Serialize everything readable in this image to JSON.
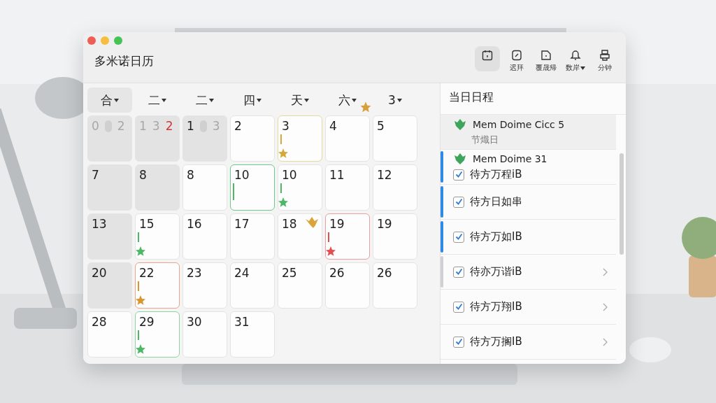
{
  "window": {
    "title": "多米诺日历",
    "controls": [
      {
        "kind": "close"
      },
      {
        "kind": "minimize"
      },
      {
        "kind": "zoom"
      }
    ]
  },
  "toolbar": [
    {
      "kind": "calendar",
      "selected": true
    },
    {
      "kind": "note",
      "label": "迟拜",
      "selected": false
    },
    {
      "kind": "file",
      "label": "覆晟帰",
      "selected": false
    },
    {
      "kind": "bell",
      "label": "数岸",
      "caret": true,
      "selected": false
    },
    {
      "kind": "printer",
      "label": "分钟",
      "selected": false
    }
  ],
  "weekdays": [
    {
      "label": "合",
      "selected": true
    },
    {
      "label": "二",
      "selected": false
    },
    {
      "label": "二",
      "selected": false
    },
    {
      "label": "四",
      "selected": false
    },
    {
      "label": "天",
      "selected": false
    },
    {
      "label": "六",
      "selected": false,
      "star": true
    },
    {
      "label": "3",
      "selected": false
    }
  ],
  "cells": [
    {
      "shaded": true,
      "parts": [
        {
          "kind": "number",
          "text": "0",
          "dimmed": true,
          "alert": false
        },
        {
          "kind": "pill"
        },
        {
          "kind": "number",
          "text": "2",
          "dimmed": true,
          "alert": false
        }
      ]
    },
    {
      "shaded": true,
      "parts": [
        {
          "kind": "number",
          "text": "1",
          "dimmed": true,
          "alert": false
        },
        {
          "kind": "number",
          "text": "3",
          "dimmed": true,
          "alert": false
        },
        {
          "kind": "number",
          "text": "2",
          "dimmed": false,
          "alert": true
        }
      ]
    },
    {
      "shaded": true,
      "parts": [
        {
          "kind": "number",
          "text": "1",
          "dimmed": false,
          "alert": false
        },
        {
          "kind": "pill"
        },
        {
          "kind": "number",
          "text": "3",
          "dimmed": true,
          "alert": false
        }
      ]
    },
    {
      "shaded": false,
      "parts": [
        {
          "kind": "number",
          "text": "2",
          "dimmed": false,
          "alert": false
        }
      ]
    },
    {
      "shaded": false,
      "parts": [
        {
          "kind": "number",
          "text": "3",
          "dimmed": false,
          "alert": false
        }
      ],
      "outline": {
        "color": "#e6d9a0"
      },
      "marker": {
        "color": "#d4a93a",
        "star": true
      }
    },
    {
      "shaded": false,
      "parts": [
        {
          "kind": "number",
          "text": "4",
          "dimmed": false,
          "alert": false
        }
      ]
    },
    {
      "shaded": false,
      "parts": [
        {
          "kind": "number",
          "text": "5",
          "dimmed": false,
          "alert": false
        }
      ]
    },
    {
      "shaded": true,
      "parts": [
        {
          "kind": "number",
          "text": "7",
          "dimmed": false,
          "alert": false
        }
      ]
    },
    {
      "shaded": true,
      "parts": [
        {
          "kind": "number",
          "text": "8",
          "dimmed": false,
          "alert": false
        }
      ]
    },
    {
      "shaded": false,
      "parts": [
        {
          "kind": "number",
          "text": "8",
          "dimmed": false,
          "alert": false
        }
      ]
    },
    {
      "shaded": false,
      "parts": [
        {
          "kind": "number",
          "text": "10",
          "dimmed": false,
          "alert": false
        }
      ],
      "outline": {
        "color": "#6cc98a"
      },
      "marker": {
        "color": "#4cb865",
        "star": false
      }
    },
    {
      "shaded": false,
      "parts": [
        {
          "kind": "number",
          "text": "10",
          "dimmed": false,
          "alert": false
        }
      ],
      "marker": {
        "color": "#4cb865",
        "star": true
      }
    },
    {
      "shaded": false,
      "parts": [
        {
          "kind": "number",
          "text": "11",
          "dimmed": false,
          "alert": false
        }
      ]
    },
    {
      "shaded": false,
      "parts": [
        {
          "kind": "number",
          "text": "12",
          "dimmed": false,
          "alert": false
        }
      ]
    },
    {
      "shaded": true,
      "parts": [
        {
          "kind": "number",
          "text": "13",
          "dimmed": false,
          "alert": false
        }
      ]
    },
    {
      "shaded": false,
      "parts": [
        {
          "kind": "number",
          "text": "15",
          "dimmed": false,
          "alert": false
        }
      ],
      "marker": {
        "color": "#4cb865",
        "star": true
      }
    },
    {
      "shaded": false,
      "parts": [
        {
          "kind": "number",
          "text": "16",
          "dimmed": false,
          "alert": false
        }
      ]
    },
    {
      "shaded": false,
      "parts": [
        {
          "kind": "number",
          "text": "17",
          "dimmed": false,
          "alert": false
        }
      ]
    },
    {
      "shaded": false,
      "parts": [
        {
          "kind": "number",
          "text": "18",
          "dimmed": false,
          "alert": false
        }
      ],
      "badge": true
    },
    {
      "shaded": false,
      "parts": [
        {
          "kind": "number",
          "text": "19",
          "dimmed": false,
          "alert": false
        }
      ],
      "outline": {
        "color": "#e8a0a0"
      },
      "marker": {
        "color": "#e05050",
        "star": true
      }
    },
    {
      "shaded": false,
      "parts": [
        {
          "kind": "number",
          "text": "19",
          "dimmed": false,
          "alert": false
        }
      ]
    },
    {
      "shaded": true,
      "parts": [
        {
          "kind": "number",
          "text": "20",
          "dimmed": false,
          "alert": false
        }
      ]
    },
    {
      "shaded": false,
      "parts": [
        {
          "kind": "number",
          "text": "22",
          "dimmed": false,
          "alert": false
        }
      ],
      "outline": {
        "color": "#eba58a"
      },
      "marker": {
        "color": "#d9952e",
        "star": true
      }
    },
    {
      "shaded": false,
      "parts": [
        {
          "kind": "number",
          "text": "23",
          "dimmed": false,
          "alert": false
        }
      ]
    },
    {
      "shaded": false,
      "parts": [
        {
          "kind": "number",
          "text": "24",
          "dimmed": false,
          "alert": false
        }
      ]
    },
    {
      "shaded": false,
      "parts": [
        {
          "kind": "number",
          "text": "25",
          "dimmed": false,
          "alert": false
        }
      ]
    },
    {
      "shaded": false,
      "parts": [
        {
          "kind": "number",
          "text": "26",
          "dimmed": false,
          "alert": false
        }
      ]
    },
    {
      "shaded": false,
      "parts": [
        {
          "kind": "number",
          "text": "26",
          "dimmed": false,
          "alert": false
        }
      ]
    },
    {
      "shaded": false,
      "parts": [
        {
          "kind": "number",
          "text": "28",
          "dimmed": false,
          "alert": false
        }
      ]
    },
    {
      "shaded": false,
      "parts": [
        {
          "kind": "number",
          "text": "29",
          "dimmed": false,
          "alert": false
        }
      ],
      "outline": {
        "color": "#8fd4a0"
      },
      "marker": {
        "color": "#4cb865",
        "star": true
      }
    },
    {
      "shaded": false,
      "parts": [
        {
          "kind": "number",
          "text": "30",
          "dimmed": false,
          "alert": false
        }
      ]
    },
    {
      "shaded": false,
      "parts": [
        {
          "kind": "number",
          "text": "31",
          "dimmed": false,
          "alert": false
        }
      ]
    }
  ],
  "schedule": {
    "title": "当日日程",
    "items": [
      {
        "kind": "holiday",
        "title": "Mem Doime Cicc 5",
        "subtitle": "节熾日"
      },
      {
        "kind": "event",
        "title": "Mem Doime 31",
        "label": "待方万程iB",
        "checked": true,
        "color": "#2f8ae6",
        "chevron": false
      },
      {
        "kind": "todo",
        "label": "待方日如串",
        "checked": true,
        "color": "#2f8ae6",
        "chevron": false
      },
      {
        "kind": "todo",
        "label": "待方万如IB",
        "checked": true,
        "color": "#2f8ae6",
        "chevron": false
      },
      {
        "kind": "todo",
        "label": "待亦万谐iB",
        "checked": true,
        "color": "#d0d0d4",
        "chevron": true
      },
      {
        "kind": "todo",
        "label": "待方万翔IB",
        "checked": true,
        "chevron": true
      },
      {
        "kind": "todo",
        "label": "待方万搁IB",
        "checked": true,
        "chevron": true
      }
    ]
  }
}
